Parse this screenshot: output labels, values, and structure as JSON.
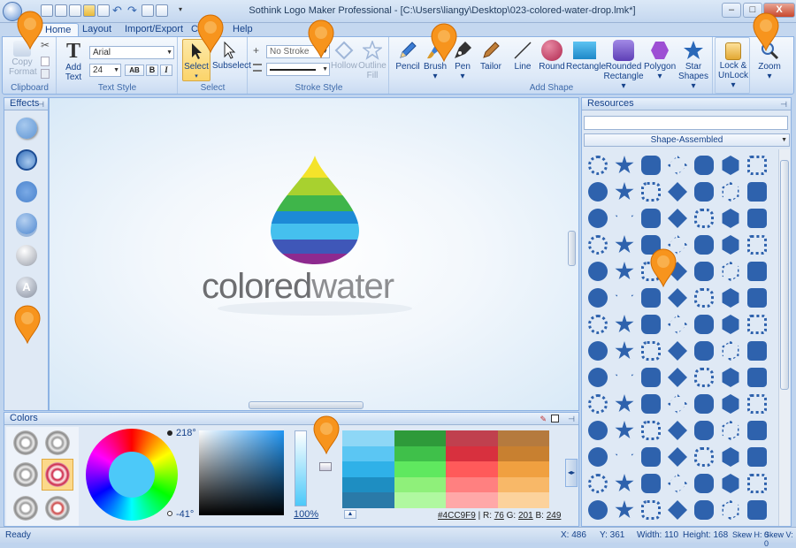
{
  "window": {
    "title": "Sothink Logo Maker Professional - [C:\\Users\\liangy\\Desktop\\023-colored-water-drop.lmk*]",
    "controls": [
      "–",
      "□",
      "X"
    ]
  },
  "menu_tabs": [
    {
      "label": "Home",
      "active": true
    },
    {
      "label": "Layout"
    },
    {
      "label": "Import/Export"
    },
    {
      "label": "C"
    },
    {
      "label": "Help"
    }
  ],
  "ribbon": {
    "clipboard": {
      "group_label": "Clipboard",
      "copy_format_line1": "Copy",
      "copy_format_line2": "Format"
    },
    "text_style": {
      "group_label": "Text Style",
      "add_text_line1": "Add",
      "add_text_line2": "Text",
      "font_name": "Arial",
      "font_size": "24",
      "spacing_label": "AB",
      "bold": "B",
      "italic": "I"
    },
    "select": {
      "group_label": "Select",
      "select_label": "Select",
      "subselect_label": "Subselect"
    },
    "stroke_style": {
      "group_label": "Stroke Style",
      "stroke_value": "No Stroke",
      "hollow_label": "Hollow",
      "outline_fill_line1": "Outline",
      "outline_fill_line2": "Fill"
    },
    "add_shape": {
      "group_label": "Add Shape",
      "tools": [
        {
          "line1": "Pencil",
          "line2": ""
        },
        {
          "line1": "Brush",
          "line2": "▾"
        },
        {
          "line1": "Pen",
          "line2": "▾"
        },
        {
          "line1": "Tailor",
          "line2": ""
        },
        {
          "line1": "Line",
          "line2": ""
        },
        {
          "line1": "Round",
          "line2": ""
        },
        {
          "line1": "Rectangle",
          "line2": ""
        },
        {
          "line1": "Rounded",
          "line2": "Rectangle ▾"
        },
        {
          "line1": "Polygon",
          "line2": "▾"
        },
        {
          "line1": "Star",
          "line2": "Shapes ▾"
        }
      ]
    },
    "lock": {
      "line1": "Lock &",
      "line2": "UnLock ▾"
    },
    "zoom": {
      "line1": "Zoom",
      "line2": "▾"
    }
  },
  "effects_panel": {
    "title": "Effects"
  },
  "canvas": {
    "logo_word1": "colored",
    "logo_word2": "water",
    "drop_colors": [
      "#f4e32a",
      "#a8d12f",
      "#3fb54a",
      "#1d8ad6",
      "#45c0ee",
      "#3f57b8",
      "#8e2a8f"
    ]
  },
  "resources_panel": {
    "title": "Resources",
    "search_value": "",
    "category": "Shape-Assembled",
    "shape_color": "#2e62ad"
  },
  "colors_panel": {
    "title": "Colors",
    "hue_label": "218°",
    "angle_label": "-41°",
    "opacity_value": "100",
    "opacity_unit": "%",
    "hex_value": "#4CC9F9",
    "r_label": "R:",
    "r_value": "76",
    "g_label": "G:",
    "g_value": "201",
    "b_label": "B:",
    "b_value": "249",
    "selected_color": "#4cc9f9",
    "palette": [
      [
        "#8ed7f6",
        "#2e9a3a",
        "#c0404e",
        "#b57a3e"
      ],
      [
        "#5bc6f3",
        "#3fc04a",
        "#d8303e",
        "#c88030"
      ],
      [
        "#2fb1e8",
        "#5fe85f",
        "#ff5a5a",
        "#f0a040"
      ],
      [
        "#1e8ec2",
        "#8ff07a",
        "#ff8080",
        "#f8b868"
      ],
      [
        "#2a7aa8",
        "#b0f8a0",
        "#ffa8a8",
        "#fcd29c"
      ]
    ]
  },
  "statusbar": {
    "ready": "Ready",
    "x": "X: 486",
    "y": "Y: 361",
    "width": "Width: 110",
    "height": "Height: 168",
    "skew_h": "Skew H: 0",
    "skew_v": "Skew V: 0"
  }
}
